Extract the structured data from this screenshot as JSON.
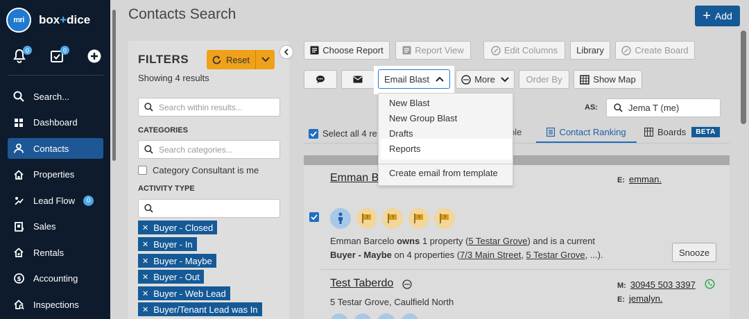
{
  "app": {
    "logo_mark": "mri",
    "logo_name_left": "box",
    "logo_plus": "+",
    "logo_name_right": "dice"
  },
  "sidebar": {
    "notifications_count": "0",
    "tasks_count": "0",
    "items": [
      {
        "label": "Search...",
        "icon": "search-icon"
      },
      {
        "label": "Dashboard",
        "icon": "dashboard-icon"
      },
      {
        "label": "Contacts",
        "icon": "contacts-icon",
        "active": true
      },
      {
        "label": "Properties",
        "icon": "home-icon"
      },
      {
        "label": "Lead Flow",
        "icon": "lead-flow-icon",
        "badge": "0"
      },
      {
        "label": "Sales",
        "icon": "sales-icon"
      },
      {
        "label": "Rentals",
        "icon": "rentals-icon"
      },
      {
        "label": "Accounting",
        "icon": "dollar-icon"
      },
      {
        "label": "Inspections",
        "icon": "inspections-icon"
      }
    ]
  },
  "header": {
    "title": "Contacts Search",
    "add_label": "Add"
  },
  "filters": {
    "title": "FILTERS",
    "reset_label": "Reset",
    "showing": "Showing 4 results",
    "search_placeholder": "Search within results...",
    "categories_label": "CATEGORIES",
    "categories_placeholder": "Search categories...",
    "consultant_checkbox": "Category Consultant is me",
    "activity_label": "ACTIVITY TYPE",
    "activity_search_value": "",
    "tags": [
      "Buyer - Closed",
      "Buyer - In",
      "Buyer - Maybe",
      "Buyer - Out",
      "Buyer - Web Lead",
      "Buyer/Tenant Lead was In"
    ]
  },
  "toolbar": {
    "choose_report": "Choose Report",
    "report_view": "Report View",
    "edit_columns": "Edit Columns",
    "library": "Library",
    "create_board": "Create Board",
    "email_blast": "Email Blast",
    "more": "More",
    "order_by": "Order By",
    "show_map": "Show Map",
    "as_label": "AS:",
    "as_value": "Jema T (me)"
  },
  "email_blast_menu": {
    "items": [
      "New Blast",
      "New Group Blast",
      "Drafts",
      "Reports"
    ],
    "highlighted": "Reports",
    "template_item": "Create email from template"
  },
  "list_header": {
    "select_all": "Select all 4 re",
    "partial_label": "ble",
    "tab_contact_ranking": "Contact Ranking",
    "tab_boards": "Boards",
    "beta": "BETA"
  },
  "results": [
    {
      "name": "Emman B",
      "email_label": "E:",
      "email": "emman.",
      "line1_pre": "Emman Barcelo ",
      "line1_bold": "owns",
      "line1_mid": " 1 property (",
      "line1_link": "5 Testar Grove",
      "line1_post": ") and is a current",
      "line2_bold": "Buyer - Maybe",
      "line2_mid": " on 4 properties (",
      "line2_link1": "7/3 Main Street",
      "line2_sep": ", ",
      "line2_link2": "5 Testar Grove",
      "line2_post": ", ...).",
      "snooze_label": "Snooze"
    },
    {
      "name": "Test Taberdo",
      "address": "5 Testar Grove, Caulfield North",
      "mobile_label": "M:",
      "mobile": "30945 503 3397",
      "email_label": "E:",
      "email": "jemalyn."
    }
  ],
  "colors": {
    "sidebar_bg": "#0d1b2c",
    "primary": "#155a96",
    "reset": "#f0a11a",
    "active_nav": "#1d5796"
  }
}
